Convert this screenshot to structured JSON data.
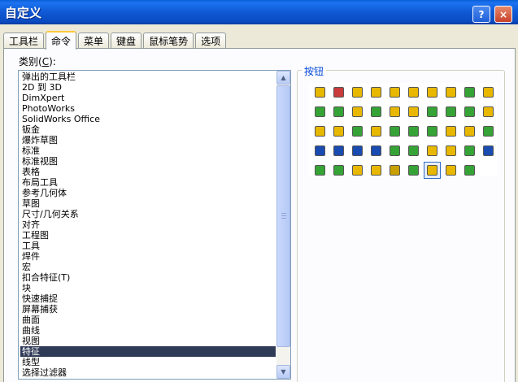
{
  "window": {
    "title": "自定义",
    "help_label": "?",
    "close_label": "×"
  },
  "tabs": [
    {
      "label": "工具栏"
    },
    {
      "label": "命令",
      "active": true
    },
    {
      "label": "菜单"
    },
    {
      "label": "键盘"
    },
    {
      "label": "鼠标笔势"
    },
    {
      "label": "选项"
    }
  ],
  "categories": {
    "label_prefix": "类别(",
    "mnemonic": "C",
    "label_suffix": "):",
    "items": [
      "弹出的工具栏",
      "2D 到 3D",
      "DimXpert",
      "PhotoWorks",
      "SolidWorks Office",
      "钣金",
      "爆炸草图",
      "标准",
      "标准视图",
      "表格",
      "布局工具",
      "参考几何体",
      "草图",
      "尺寸/几何关系",
      "对齐",
      "工程图",
      "工具",
      "焊件",
      "宏",
      "扣合特征(T)",
      "块",
      "快速捕捉",
      "屏幕捕获",
      "曲面",
      "曲线",
      "视图",
      "特征",
      "线型",
      "选择过滤器"
    ],
    "selected_index": 26
  },
  "buttons_group": {
    "title": "按钮",
    "icons": [
      {
        "name": "extruded-boss-icon",
        "color": "#e8b800"
      },
      {
        "name": "revolved-boss-icon",
        "color": "#c83c3c"
      },
      {
        "name": "swept-boss-icon",
        "color": "#e8b800"
      },
      {
        "name": "lofted-boss-icon",
        "color": "#e8b800"
      },
      {
        "name": "boundary-boss-icon",
        "color": "#e8b800"
      },
      {
        "name": "thicken-icon",
        "color": "#e8b800"
      },
      {
        "name": "extruded-cut-icon",
        "color": "#e8b800"
      },
      {
        "name": "revolved-cut-icon",
        "color": "#e8b800"
      },
      {
        "name": "swept-cut-icon",
        "color": "#36a336"
      },
      {
        "name": "lofted-cut-icon",
        "color": "#e8b800"
      },
      {
        "name": "boundary-cut-icon",
        "color": "#36a336"
      },
      {
        "name": "fillet-icon",
        "color": "#36a336"
      },
      {
        "name": "chamfer-icon",
        "color": "#e8b800"
      },
      {
        "name": "rib-icon",
        "color": "#36a336"
      },
      {
        "name": "shell-icon",
        "color": "#e8b800"
      },
      {
        "name": "draft-icon",
        "color": "#e8b800"
      },
      {
        "name": "hole-wizard-icon",
        "color": "#36a336"
      },
      {
        "name": "dome-icon",
        "color": "#36a336"
      },
      {
        "name": "wrap-icon",
        "color": "#36a336"
      },
      {
        "name": "split-line-icon",
        "color": "#e8b800"
      },
      {
        "name": "simple-hole-icon",
        "color": "#e8b800"
      },
      {
        "name": "cosmetic-thread-icon",
        "color": "#e8b800"
      },
      {
        "name": "linear-pattern-icon",
        "color": "#36a336"
      },
      {
        "name": "circular-pattern-icon",
        "color": "#e8b800"
      },
      {
        "name": "mirror-icon",
        "color": "#36a336"
      },
      {
        "name": "move-face-icon",
        "color": "#36a336"
      },
      {
        "name": "delete-face-icon",
        "color": "#36a336"
      },
      {
        "name": "replace-face-icon",
        "color": "#e8b800"
      },
      {
        "name": "flex-icon",
        "color": "#e8b800"
      },
      {
        "name": "deform-icon",
        "color": "#36a336"
      },
      {
        "name": "curve-pattern-icon",
        "color": "#1a4bb0"
      },
      {
        "name": "sketch-pattern-icon",
        "color": "#1a4bb0"
      },
      {
        "name": "table-pattern-icon",
        "color": "#1a4bb0"
      },
      {
        "name": "fill-pattern-icon",
        "color": "#1a4bb0"
      },
      {
        "name": "dimension-pattern-icon",
        "color": "#36a336"
      },
      {
        "name": "combine-icon",
        "color": "#36a336"
      },
      {
        "name": "intersect-icon",
        "color": "#e8b800"
      },
      {
        "name": "indent-icon",
        "color": "#e8b800"
      },
      {
        "name": "scale-icon",
        "color": "#36a336"
      },
      {
        "name": "design-table-icon",
        "color": "#1a4bb0"
      },
      {
        "name": "library-feature-icon",
        "color": "#36a336"
      },
      {
        "name": "split-icon",
        "color": "#36a336"
      },
      {
        "name": "move-copy-icon",
        "color": "#e8b800"
      },
      {
        "name": "cavity-icon",
        "color": "#e8b800"
      },
      {
        "name": "freeze-bar-icon",
        "color": "#c8a000"
      },
      {
        "name": "curve-driven-icon",
        "color": "#36a336"
      },
      {
        "name": "instant3d-icon",
        "color": "#e8b800"
      },
      {
        "name": "feature-works-icon",
        "color": "#e8b800"
      },
      {
        "name": "rollback-icon",
        "color": "#36a336"
      }
    ],
    "selected_index": 46
  }
}
